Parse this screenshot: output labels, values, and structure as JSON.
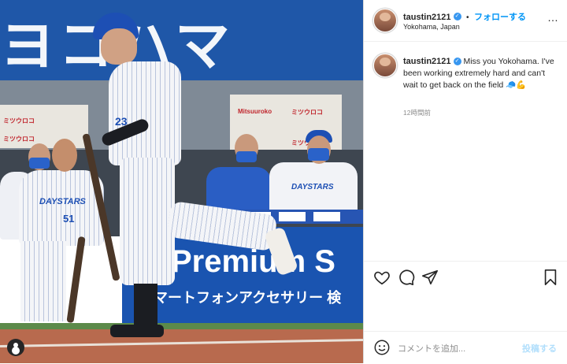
{
  "header": {
    "username": "taustin2121",
    "separator": "•",
    "follow_label": "フォローする",
    "location": "Yokohama, Japan"
  },
  "caption": {
    "username": "taustin2121",
    "text": "Miss you Yokohama. I've been working extremely hard and can't wait to get back on the field 🧢💪",
    "timestamp": "12時間前"
  },
  "comment": {
    "placeholder": "コメントを追加...",
    "post_label": "投稿する"
  },
  "photo": {
    "stand_text": "ヨコハマ",
    "board_left_1": "ミツウロコ",
    "board_left_2": "ミツウロコ",
    "board_right_1": "Mitsuuroko",
    "board_right_2": "ミツウロコ",
    "board_right_3": "ミツウロコ",
    "player_left_team": "DAYSTARS",
    "player_left_number": "51",
    "player_main_number": "23",
    "player_right_team": "DAYSTARS",
    "ad_line1": "Premium S",
    "ad_line2": "マートフォンアクセサリー 検"
  },
  "colors": {
    "accent": "#0095f6",
    "verified": "#3897f0",
    "team_blue": "#1f57a8"
  }
}
